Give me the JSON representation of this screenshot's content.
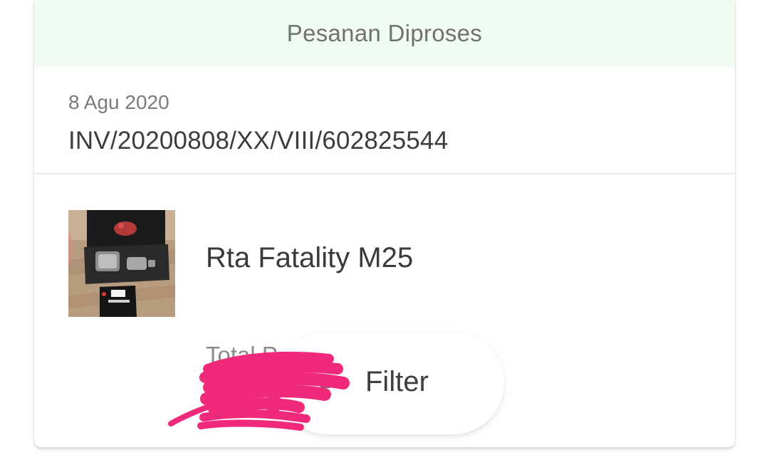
{
  "order": {
    "status": "Pesanan Diproses",
    "date": "8 Agu 2020",
    "invoice": "INV/20200808/XX/VIII/602825544"
  },
  "product": {
    "name": "Rta Fatality M25",
    "thumbnail_icon": "product-thumbnail",
    "total_label": "Total P"
  },
  "filter": {
    "label": "Filter",
    "icon": "filter-icon"
  },
  "colors": {
    "header_bg": "#f1fbf1",
    "redaction": "#f1297a",
    "accent": "#f5a623"
  }
}
